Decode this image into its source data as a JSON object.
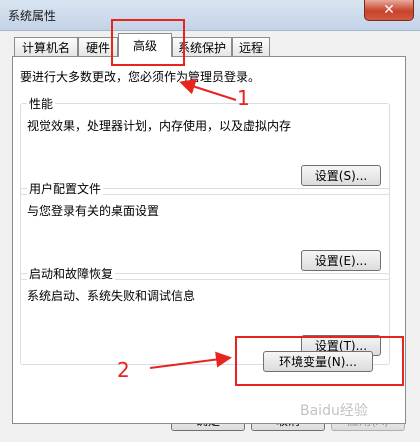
{
  "window": {
    "title": "系统属性",
    "close_icon": "close-icon"
  },
  "tabs": [
    {
      "label": "计算机名",
      "active": false
    },
    {
      "label": "硬件",
      "active": false
    },
    {
      "label": "高级",
      "active": true
    },
    {
      "label": "系统保护",
      "active": false
    },
    {
      "label": "远程",
      "active": false
    }
  ],
  "panel": {
    "admin_note": "要进行大多数更改，您必须作为管理员登录。",
    "groups": [
      {
        "title": "性能",
        "description": "视觉效果，处理器计划，内存使用，以及虚拟内存",
        "button": "设置(S)..."
      },
      {
        "title": "用户配置文件",
        "description": "与您登录有关的桌面设置",
        "button": "设置(E)..."
      },
      {
        "title": "启动和故障恢复",
        "description": "系统启动、系统失败和调试信息",
        "button": "设置(T)..."
      }
    ],
    "env_button": "环境变量(N)..."
  },
  "footer": {
    "ok": "确定",
    "cancel": "取消",
    "apply": "应用(A)"
  },
  "annotations": {
    "step1": "1",
    "step2": "2",
    "color": "#e8241f"
  },
  "watermark": "Baidu经验"
}
